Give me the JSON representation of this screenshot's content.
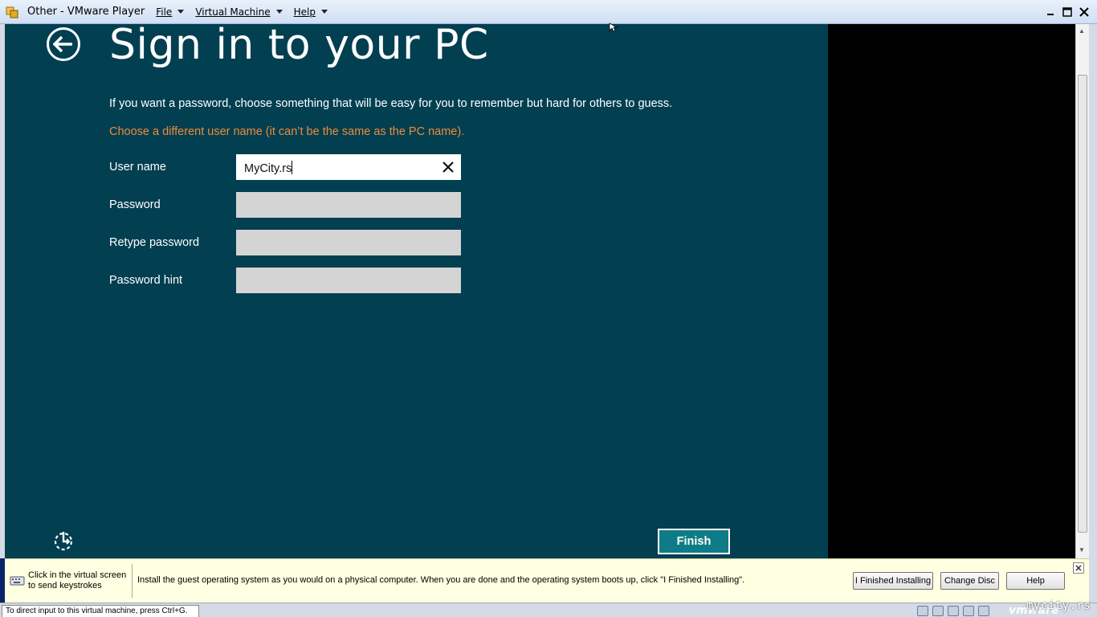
{
  "window": {
    "title": "Other - VMware Player",
    "menus": [
      {
        "label": "File"
      },
      {
        "label": "Virtual Machine"
      },
      {
        "label": "Help"
      }
    ]
  },
  "setup": {
    "title": "Sign in to your PC",
    "instruction": "If you want a password, choose something that will be easy for you to remember but hard for others to guess.",
    "error": "Choose a different user name (it can’t be the same as the PC name).",
    "fields": [
      {
        "label": "User name",
        "value": "MyCity.rs"
      },
      {
        "label": "Password",
        "value": ""
      },
      {
        "label": "Retype password",
        "value": ""
      },
      {
        "label": "Password hint",
        "value": ""
      }
    ],
    "finish_label": "Finish"
  },
  "hintbar": {
    "click_line1": "Click in the virtual screen",
    "click_line2": "to send keystrokes",
    "message": "Install the guest operating system as you would on a physical computer. When you are done and the operating system boots up, click \"I Finished Installing\".",
    "buttons": [
      {
        "label": "I Finished Installing"
      },
      {
        "label": "Change Disc"
      },
      {
        "label": "Help"
      }
    ]
  },
  "statusbar": {
    "text": "To direct input to this virtual machine, press Ctrl+G.",
    "brand": "vmware"
  },
  "watermark": "mycity.rs"
}
